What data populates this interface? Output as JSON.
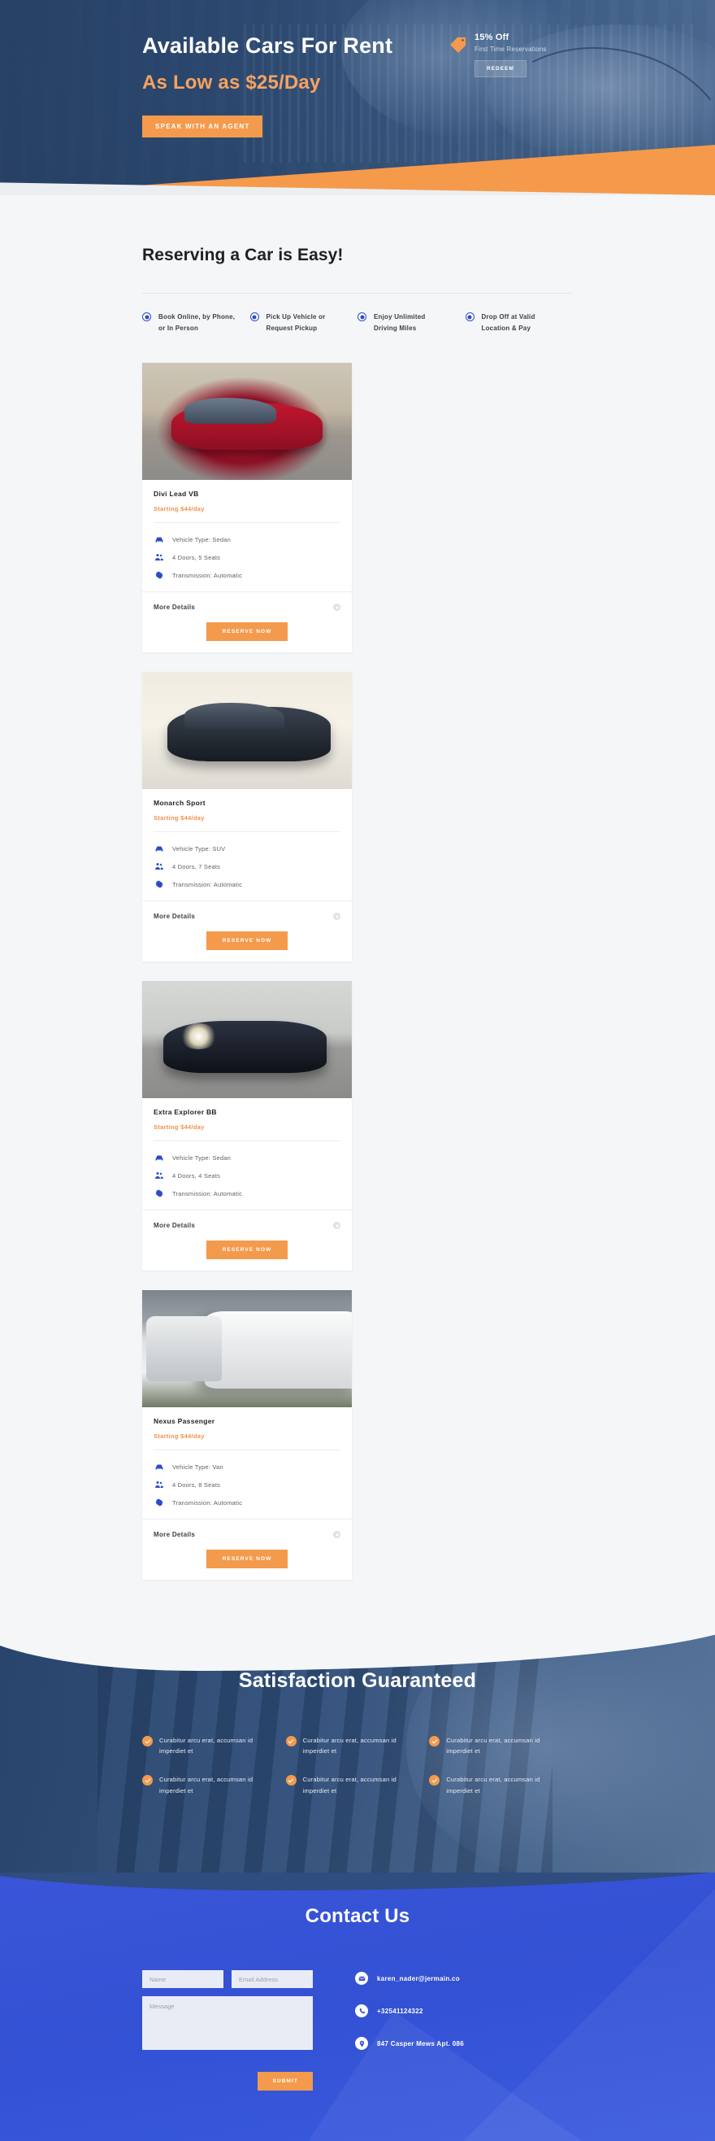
{
  "hero": {
    "title": "Available Cars For Rent",
    "subtitle": "As Low as $25/Day",
    "cta_label": "SPEAK WITH AN AGENT",
    "promo": {
      "headline": "15% Off",
      "subtext": "First Time Reservations",
      "button_label": "REDEEM",
      "tag_icon": "price-tag-icon"
    },
    "colors": {
      "bg": "#2d4972",
      "accent": "#f49a4c",
      "title": "#ffffff",
      "subtitle": "#f7a261"
    }
  },
  "steps_section": {
    "title": "Reserving a Car is Easy!",
    "steps": [
      {
        "label": "Book Online, by Phone,\nor In Person"
      },
      {
        "label": "Pick Up Vehicle or\nRequest Pickup"
      },
      {
        "label": "Enjoy Unlimited\nDriving Miles"
      },
      {
        "label": "Drop Off at Valid\nLocation & Pay"
      }
    ],
    "dot_color": "#2c4bc9"
  },
  "cards": [
    {
      "name": "Divi Lead VB",
      "price": "Starting $44/day",
      "photo": "red-sedan-photo",
      "specs": [
        {
          "icon": "car-icon",
          "text": "Vehicle Type: Sedan"
        },
        {
          "icon": "seats-icon",
          "text": "4 Doors, 5 Seats"
        },
        {
          "icon": "gear-icon",
          "text": "Transmission: Automatic"
        }
      ],
      "more_label": "More Details",
      "reserve_label": "RESERVE NOW"
    },
    {
      "name": "Monarch Sport",
      "price": "Starting $44/day",
      "photo": "dark-suv-photo",
      "specs": [
        {
          "icon": "car-icon",
          "text": "Vehicle Type: SUV"
        },
        {
          "icon": "seats-icon",
          "text": "4 Doors, 7 Seats"
        },
        {
          "icon": "gear-icon",
          "text": "Transmission: Automatic"
        }
      ],
      "more_label": "More Details",
      "reserve_label": "RESERVE NOW"
    },
    {
      "name": "Extra Explorer BB",
      "price": "Starting $44/day",
      "photo": "black-hatchback-photo",
      "specs": [
        {
          "icon": "car-icon",
          "text": "Vehicle Type: Sedan"
        },
        {
          "icon": "seats-icon",
          "text": "4 Doors, 4 Seats"
        },
        {
          "icon": "gear-icon",
          "text": "Transmission: Automatic"
        }
      ],
      "more_label": "More Details",
      "reserve_label": "RESERVE NOW"
    },
    {
      "name": "Nexus Passenger",
      "price": "Starting $44/day",
      "photo": "white-trucks-photo",
      "specs": [
        {
          "icon": "car-icon",
          "text": "Vehicle Type: Van"
        },
        {
          "icon": "seats-icon",
          "text": "4 Doors, 8 Seats"
        },
        {
          "icon": "gear-icon",
          "text": "Transmission: Automatic"
        }
      ],
      "more_label": "More Details",
      "reserve_label": "RESERVE NOW"
    }
  ],
  "satisfaction": {
    "title": "Satisfaction Guaranteed",
    "items": [
      {
        "text": "Curabitur arcu erat, accumsan id imperdiet et"
      },
      {
        "text": "Curabitur arcu erat, accumsan id imperdiet et"
      },
      {
        "text": "Curabitur arcu erat, accumsan id imperdiet et"
      },
      {
        "text": "Curabitur arcu erat, accumsan id imperdiet et"
      },
      {
        "text": "Curabitur arcu erat, accumsan id imperdiet et"
      },
      {
        "text": "Curabitur arcu erat, accumsan id imperdiet et"
      }
    ],
    "check_color": "#f49a4c"
  },
  "contact": {
    "title": "Contact Us",
    "form": {
      "name_placeholder": "Name",
      "name_value": "",
      "email_placeholder": "Email Address",
      "email_value": "",
      "message_placeholder": "Message",
      "message_value": "",
      "submit_label": "SUBMIT"
    },
    "details": [
      {
        "icon": "email-icon",
        "text": "karen_nader@jermain.co"
      },
      {
        "icon": "phone-icon",
        "text": "+32541124322"
      },
      {
        "icon": "location-pin-icon",
        "text": "847 Casper Mews Apt. 086"
      }
    ],
    "bg_color": "#3351d4"
  }
}
